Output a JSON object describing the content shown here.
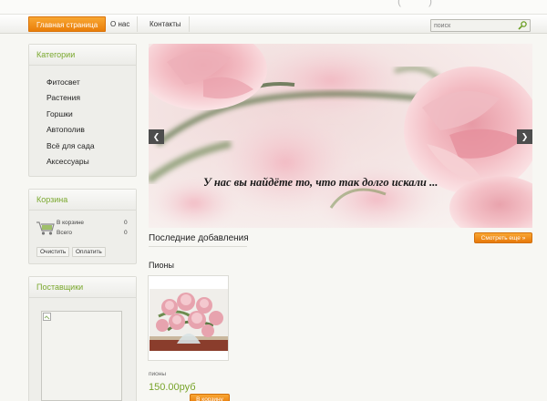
{
  "nav": {
    "items": [
      {
        "label": "Главная страница",
        "active": true
      },
      {
        "label": "О нас",
        "active": false
      },
      {
        "label": "Контакты",
        "active": false
      }
    ],
    "search_placeholder": "поиск"
  },
  "categories": {
    "title": "Категории",
    "items": [
      "Фитосвет",
      "Растения",
      "Горшки",
      "Автополив",
      "Всё для сада",
      "Аксессуары"
    ]
  },
  "cart": {
    "title": "Корзина",
    "in_cart_label": "В корзине",
    "in_cart_count": "0",
    "total_label": "Всего",
    "total_value": "0",
    "clear_label": "Очистить",
    "pay_label": "Оплатить"
  },
  "suppliers": {
    "title": "Поставщики"
  },
  "slider": {
    "caption": "У нас вы найдёте то, что так долго искали ...",
    "prev_icon": "chevron-left-icon",
    "next_icon": "chevron-right-icon"
  },
  "latest": {
    "title": "Последние добавления",
    "more_label": "Смотреть еще »",
    "product_category": "Пионы",
    "product_name": "пионы",
    "product_price": "150.00руб",
    "buy_label": "В корзину"
  },
  "colors": {
    "accent_orange": "#ef8a10",
    "green_text": "#7aa82e"
  }
}
